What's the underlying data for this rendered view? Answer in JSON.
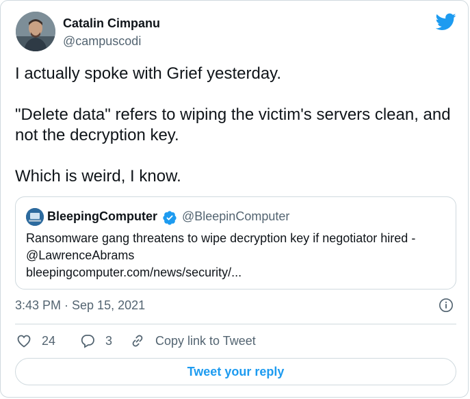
{
  "colors": {
    "brand": "#1d9bf0",
    "text": "#0f1419",
    "muted": "#536471",
    "border": "#cfd9de"
  },
  "author": {
    "name": "Catalin Cimpanu",
    "handle": "@campuscodi",
    "avatar_icon": "profile-photo"
  },
  "tweet": {
    "lines": [
      "I actually spoke with Grief yesterday.",
      "\"Delete data\" refers to wiping the victim's servers clean, and not the decryption key.",
      "Which is weird, I know."
    ]
  },
  "quoted": {
    "name": "BleepingComputer",
    "handle": "@BleepinComputer",
    "verified": true,
    "text_lines": [
      "Ransomware gang threatens to wipe decryption key if negotiator hired -",
      "@LawrenceAbrams",
      "bleepingcomputer.com/news/security/..."
    ]
  },
  "meta": {
    "timestamp": "3:43 PM · Sep 15, 2021",
    "info_icon": "info-icon"
  },
  "actions": {
    "likes": "24",
    "replies": "3",
    "copy_label": "Copy link to Tweet",
    "reply_button": "Tweet your reply"
  }
}
